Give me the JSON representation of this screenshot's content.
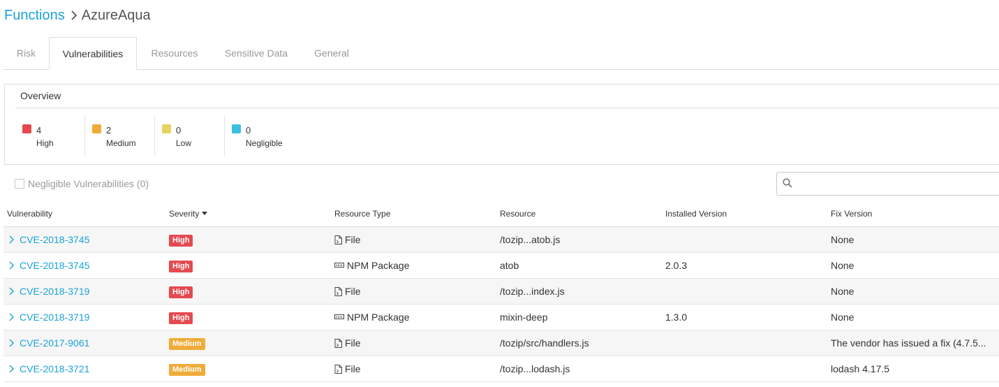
{
  "breadcrumb": {
    "parent": "Functions",
    "separator_icon": "chevron-right-icon",
    "current": "AzureAqua"
  },
  "tabs": [
    {
      "label": "Risk",
      "active": false
    },
    {
      "label": "Vulnerabilities",
      "active": true
    },
    {
      "label": "Resources",
      "active": false
    },
    {
      "label": "Sensitive Data",
      "active": false
    },
    {
      "label": "General",
      "active": false
    }
  ],
  "overview": {
    "title": "Overview",
    "counts": [
      {
        "value": "4",
        "label": "High",
        "color": "#e5494f"
      },
      {
        "value": "2",
        "label": "Medium",
        "color": "#f0ac38"
      },
      {
        "value": "0",
        "label": "Low",
        "color": "#e6d25f"
      },
      {
        "value": "0",
        "label": "Negligible",
        "color": "#3cbfe0"
      }
    ]
  },
  "filter": {
    "label": "Negligible Vulnerabilities (0)",
    "checked": false
  },
  "search": {
    "placeholder": "",
    "value": "",
    "icon": "search-icon"
  },
  "table": {
    "columns": [
      "Vulnerability",
      "Severity",
      "Resource Type",
      "Resource",
      "Installed Version",
      "Fix Version"
    ],
    "sort_icon": "caret-down-icon",
    "severity_colors": {
      "High": "#e5494f",
      "Medium": "#f0ac38"
    },
    "rows": [
      {
        "vulnerability": "CVE-2018-3745",
        "severity": "High",
        "resource_type": "File",
        "type_icon": "file-icon",
        "resource": "/tozip...atob.js",
        "installed": "",
        "fix": "None"
      },
      {
        "vulnerability": "CVE-2018-3745",
        "severity": "High",
        "resource_type": "NPM Package",
        "type_icon": "package-icon",
        "resource": "atob",
        "installed": "2.0.3",
        "fix": "None"
      },
      {
        "vulnerability": "CVE-2018-3719",
        "severity": "High",
        "resource_type": "File",
        "type_icon": "file-icon",
        "resource": "/tozip...index.js",
        "installed": "",
        "fix": "None"
      },
      {
        "vulnerability": "CVE-2018-3719",
        "severity": "High",
        "resource_type": "NPM Package",
        "type_icon": "package-icon",
        "resource": "mixin-deep",
        "installed": "1.3.0",
        "fix": "None"
      },
      {
        "vulnerability": "CVE-2017-9061",
        "severity": "Medium",
        "resource_type": "File",
        "type_icon": "file-icon",
        "resource": "/tozip/src/handlers.js",
        "installed": "",
        "fix": "The vendor has issued a fix (4.7.5..."
      },
      {
        "vulnerability": "CVE-2018-3721",
        "severity": "Medium",
        "resource_type": "File",
        "type_icon": "file-icon",
        "resource": "/tozip...lodash.js",
        "installed": "",
        "fix": "lodash 4.17.5"
      }
    ]
  }
}
